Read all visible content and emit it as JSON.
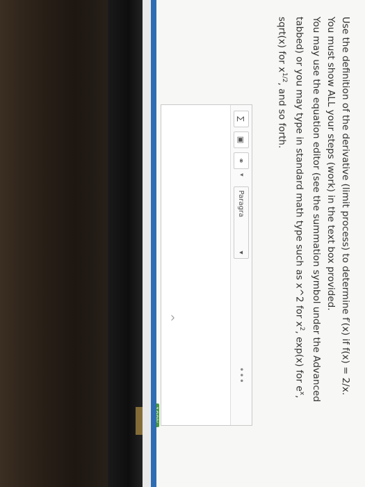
{
  "question": {
    "line1": "Use the definition of the derivative (limit process) to determine f′(x) if f(x) = 2/x.",
    "line2": "You must show ALL your steps (work) in the text box provided.",
    "line3a": "You may use the equation editor (see the summation symbol under the Advanced",
    "line3b": "tabbed) or you may type in standard math type such as x^2 for x",
    "line3b_sup": "2",
    "line3b_tail": ", exp(x) for e",
    "line3b_sup2": "x",
    "line3b_end": ",",
    "line4a": "sqrt(x) for x",
    "line4_sup": "1/2",
    "line4b": ", and so forth."
  },
  "editor": {
    "paragraph_label": "Paragra",
    "more_label": "•••",
    "expand_label": "^"
  },
  "status": {
    "zoom": "100%"
  },
  "colors": {
    "blue_bar": "#2f6db3",
    "zoom_badge": "#4a9b3a"
  }
}
